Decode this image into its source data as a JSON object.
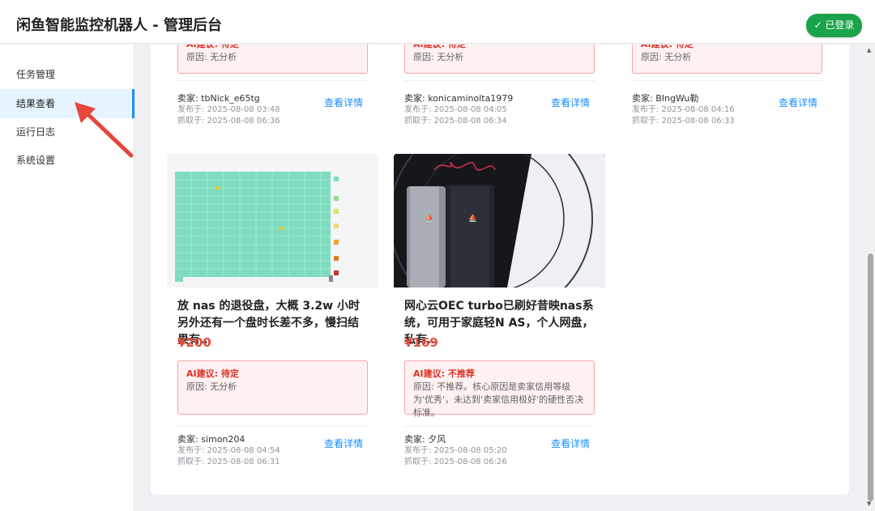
{
  "header": {
    "title": "闲鱼智能监控机器人 - 管理后台",
    "login_label": "✓ 已登录"
  },
  "sidebar": {
    "items": [
      {
        "label": "任务管理"
      },
      {
        "label": "结果查看"
      },
      {
        "label": "运行日志"
      },
      {
        "label": "系统设置"
      }
    ]
  },
  "common": {
    "detail_link": "查看详情"
  },
  "top_cards": [
    {
      "ai_label": "AI建议: 待定",
      "ai_reason": "原因: 无分析",
      "seller": "卖家: tbNick_e65tg",
      "published": "发布于: 2025-08-08 03:48",
      "crawled": "抓取于: 2025-08-08 06:36"
    },
    {
      "ai_label": "AI建议: 待定",
      "ai_reason": "原因: 无分析",
      "seller": "卖家: konicaminolta1979",
      "published": "发布于: 2025-08-08 04:05",
      "crawled": "抓取于: 2025-08-08 06:34"
    },
    {
      "ai_label": "AI建议: 待定",
      "ai_reason": "原因: 无分析",
      "seller": "卖家: BIngWu勒",
      "published": "发布于: 2025-08-08 04:16",
      "crawled": "抓取于: 2025-08-08 06:33"
    }
  ],
  "bottom_cards": [
    {
      "title": "放 nas 的退役盘，大概 3.2w 小时 另外还有一个盘时长差不多，慢扫结果有…",
      "price": "¥200",
      "ai_label": "AI建议: 待定",
      "ai_reason": "原因: 无分析",
      "seller": "卖家: simon204",
      "published": "发布于: 2025-08-08 04:54",
      "crawled": "抓取于: 2025-08-08 06:31",
      "image_icon": "disk-scan-screenshot"
    },
    {
      "title": "网心云OEC turbo已刷好昔映nas系统，可用于家庭轻N AS，个人网盘，私有…",
      "price": "¥169",
      "ai_label": "AI建议: 不推荐",
      "ai_reason": "原因: 不推荐。核心原因是卖家信用等级为'优秀'，未达到'卖家信用极好'的硬性否决标准。",
      "seller": "卖家: 夕风",
      "published": "发布于: 2025-08-08 05:20",
      "crawled": "抓取于: 2025-08-08 06:26",
      "image_icon": "device-photo"
    }
  ],
  "colors": {
    "accent": "#1890ff",
    "login_green": "#1aa34a",
    "price_red": "#e74c3c",
    "warning_red": "#d93025",
    "arrow_red": "#e8453c"
  }
}
